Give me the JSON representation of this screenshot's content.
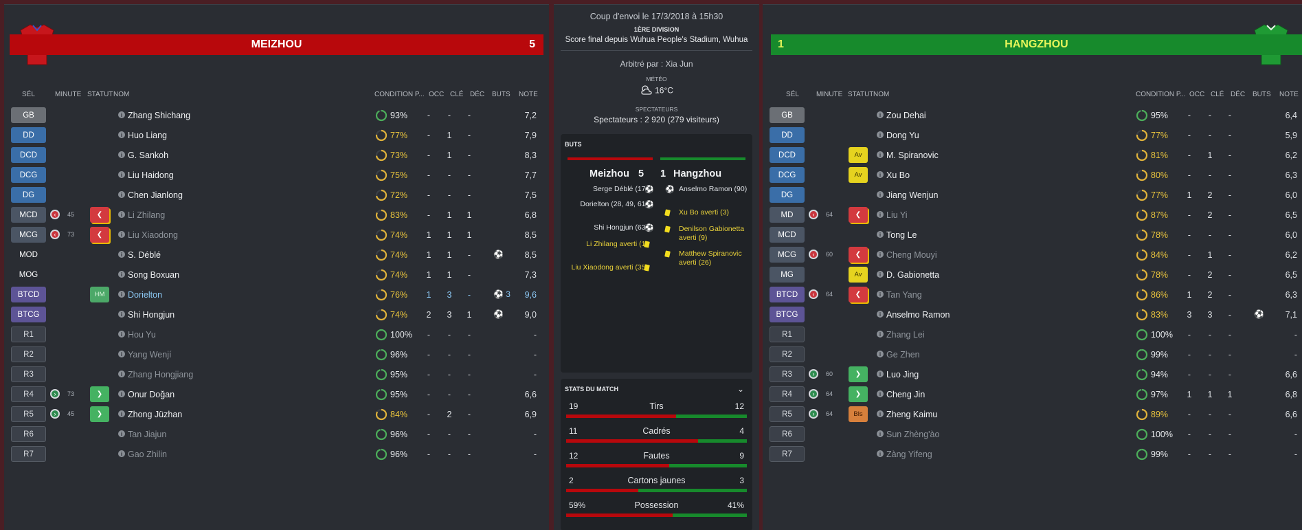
{
  "home": {
    "name": "MEIZHOU",
    "score": "5",
    "color": "#b8080c",
    "headers": {
      "sel": "SÉL",
      "minute": "MINUTE",
      "statut": "STATUT",
      "nom": "NOM",
      "cond": "CONDITION P...",
      "occ": "OCC",
      "cle": "CLÉ",
      "dec": "DÉC",
      "buts": "BUTS",
      "note": "NOTE"
    },
    "players": [
      {
        "pos": "GB",
        "pk": "gk",
        "name": "Zhang Shichang",
        "cond": "93%",
        "cc": "g",
        "occ": "-",
        "cle": "-",
        "dec": "-",
        "buts": "",
        "note": "7,2"
      },
      {
        "pos": "DD",
        "pk": "def",
        "name": "Huo Liang",
        "cond": "77%",
        "cc": "y",
        "occ": "-",
        "cle": "1",
        "dec": "-",
        "buts": "",
        "note": "7,9"
      },
      {
        "pos": "DCD",
        "pk": "def",
        "name": "G. Sankoh",
        "cond": "73%",
        "cc": "y",
        "occ": "-",
        "cle": "1",
        "dec": "-",
        "buts": "",
        "note": "8,3"
      },
      {
        "pos": "DCG",
        "pk": "def",
        "name": "Liu Haidong",
        "cond": "75%",
        "cc": "y",
        "occ": "-",
        "cle": "-",
        "dec": "-",
        "buts": "",
        "note": "7,7"
      },
      {
        "pos": "DG",
        "pk": "def",
        "name": "Chen Jianlong",
        "cond": "72%",
        "cc": "y",
        "occ": "-",
        "cle": "-",
        "dec": "-",
        "buts": "",
        "note": "7,5"
      },
      {
        "pos": "MCD",
        "pk": "mid",
        "sub": "out",
        "minute": "45",
        "status": "red",
        "status_text": "❮",
        "name": "Li Zhilang",
        "nk": "out",
        "cond": "83%",
        "cc": "y",
        "occ": "-",
        "cle": "1",
        "dec": "1",
        "buts": "",
        "note": "6,8"
      },
      {
        "pos": "MCG",
        "pk": "mid",
        "sub": "out",
        "minute": "73",
        "status": "red",
        "status_text": "❮",
        "name": "Liu Xiaodong",
        "nk": "out",
        "cond": "74%",
        "cc": "y",
        "occ": "1",
        "cle": "1",
        "dec": "1",
        "buts": "",
        "note": "8,5"
      },
      {
        "pos": "MOD",
        "pk": "plain",
        "name": "S. Déblé",
        "cond": "74%",
        "cc": "y",
        "occ": "1",
        "cle": "1",
        "dec": "-",
        "buts": "⚽",
        "note": "8,5"
      },
      {
        "pos": "MOG",
        "pk": "plain",
        "name": "Song Boxuan",
        "cond": "74%",
        "cc": "y",
        "occ": "1",
        "cle": "1",
        "dec": "-",
        "buts": "",
        "note": "7,3"
      },
      {
        "pos": "BTCD",
        "pk": "att",
        "status": "hm",
        "status_text": "HM",
        "name": "Dorielton",
        "nk": "star",
        "cond": "76%",
        "cc": "y",
        "occ": "1",
        "cle": "3",
        "dec": "-",
        "buts": "⚽ 3",
        "note": "9,6",
        "star": true
      },
      {
        "pos": "BTCG",
        "pk": "att",
        "name": "Shi Hongjun",
        "cond": "74%",
        "cc": "y",
        "occ": "2",
        "cle": "3",
        "dec": "1",
        "buts": "⚽",
        "note": "9,0"
      },
      {
        "pos": "R1",
        "pk": "res",
        "name": "Hou Yu",
        "nk": "dim",
        "cond": "100%",
        "cc": "g",
        "occ": "-",
        "cle": "-",
        "dec": "-",
        "buts": "",
        "note": "-"
      },
      {
        "pos": "R2",
        "pk": "res",
        "name": "Yang Wenjí",
        "nk": "dim",
        "cond": "96%",
        "cc": "g",
        "occ": "-",
        "cle": "-",
        "dec": "-",
        "buts": "",
        "note": "-"
      },
      {
        "pos": "R3",
        "pk": "res",
        "name": "Zhang Hongjiang",
        "nk": "dim",
        "cond": "95%",
        "cc": "g",
        "occ": "-",
        "cle": "-",
        "dec": "-",
        "buts": "",
        "note": "-"
      },
      {
        "pos": "R4",
        "pk": "res",
        "sub": "in",
        "minute": "73",
        "status": "green",
        "status_text": "❯",
        "name": "Onur Doğan",
        "cond": "95%",
        "cc": "g",
        "occ": "-",
        "cle": "-",
        "dec": "-",
        "buts": "",
        "note": "6,6"
      },
      {
        "pos": "R5",
        "pk": "res",
        "sub": "in",
        "minute": "45",
        "status": "green",
        "status_text": "❯",
        "name": "Zhong Jüzhan",
        "cond": "84%",
        "cc": "y",
        "occ": "-",
        "cle": "2",
        "dec": "-",
        "buts": "",
        "note": "6,9"
      },
      {
        "pos": "R6",
        "pk": "res",
        "name": "Tan Jiajun",
        "nk": "dim",
        "cond": "96%",
        "cc": "g",
        "occ": "-",
        "cle": "-",
        "dec": "-",
        "buts": "",
        "note": "-"
      },
      {
        "pos": "R7",
        "pk": "res",
        "name": "Gao Zhilin",
        "nk": "dim",
        "cond": "96%",
        "cc": "g",
        "occ": "-",
        "cle": "-",
        "dec": "-",
        "buts": "",
        "note": "-"
      }
    ]
  },
  "away": {
    "name": "HANGZHOU",
    "score": "1",
    "color": "#178a2c",
    "headers": {
      "sel": "SÉL",
      "minute": "MINUTE",
      "statut": "STATUT",
      "nom": "NOM",
      "cond": "CONDITION P...",
      "occ": "OCC",
      "cle": "CLÉ",
      "dec": "DÉC",
      "buts": "BUTS",
      "note": "NOTE"
    },
    "players": [
      {
        "pos": "GB",
        "pk": "gk",
        "name": "Zou Dehai",
        "cond": "95%",
        "cc": "g",
        "occ": "-",
        "cle": "-",
        "dec": "-",
        "buts": "",
        "note": "6,4"
      },
      {
        "pos": "DD",
        "pk": "def",
        "name": "Dong Yu",
        "cond": "77%",
        "cc": "y",
        "occ": "-",
        "cle": "-",
        "dec": "-",
        "buts": "",
        "note": "5,9"
      },
      {
        "pos": "DCD",
        "pk": "def",
        "status": "av",
        "status_text": "Av",
        "name": "M. Spiranovic",
        "cond": "81%",
        "cc": "y",
        "occ": "-",
        "cle": "1",
        "dec": "-",
        "buts": "",
        "note": "6,2"
      },
      {
        "pos": "DCG",
        "pk": "def",
        "status": "av",
        "status_text": "Av",
        "name": "Xu Bo",
        "cond": "80%",
        "cc": "y",
        "occ": "-",
        "cle": "-",
        "dec": "-",
        "buts": "",
        "note": "6,3"
      },
      {
        "pos": "DG",
        "pk": "def",
        "name": "Jiang Wenjun",
        "cond": "77%",
        "cc": "y",
        "occ": "1",
        "cle": "2",
        "dec": "-",
        "buts": "",
        "note": "6,0"
      },
      {
        "pos": "MD",
        "pk": "mid",
        "sub": "out",
        "minute": "64",
        "status": "red",
        "status_text": "❮",
        "name": "Liu Yi",
        "nk": "out",
        "cond": "87%",
        "cc": "y",
        "occ": "-",
        "cle": "2",
        "dec": "-",
        "buts": "",
        "note": "6,5"
      },
      {
        "pos": "MCD",
        "pk": "mid",
        "name": "Tong Le",
        "cond": "78%",
        "cc": "y",
        "occ": "-",
        "cle": "-",
        "dec": "-",
        "buts": "",
        "note": "6,0"
      },
      {
        "pos": "MCG",
        "pk": "mid",
        "sub": "out",
        "minute": "60",
        "status": "red",
        "status_text": "❮",
        "name": "Cheng Mouyi",
        "nk": "out",
        "cond": "84%",
        "cc": "y",
        "occ": "-",
        "cle": "1",
        "dec": "-",
        "buts": "",
        "note": "6,2"
      },
      {
        "pos": "MG",
        "pk": "mid",
        "status": "av",
        "status_text": "Av",
        "name": "D. Gabionetta",
        "cond": "78%",
        "cc": "y",
        "occ": "-",
        "cle": "2",
        "dec": "-",
        "buts": "",
        "note": "6,5"
      },
      {
        "pos": "BTCD",
        "pk": "att",
        "sub": "out",
        "minute": "64",
        "status": "red",
        "status_text": "❮",
        "name": "Tan Yang",
        "nk": "out",
        "cond": "86%",
        "cc": "y",
        "occ": "1",
        "cle": "2",
        "dec": "-",
        "buts": "",
        "note": "6,3"
      },
      {
        "pos": "BTCG",
        "pk": "att",
        "name": "Anselmo Ramon",
        "cond": "83%",
        "cc": "y",
        "occ": "3",
        "cle": "3",
        "dec": "-",
        "buts": "⚽",
        "note": "7,1"
      },
      {
        "pos": "R1",
        "pk": "res",
        "name": "Zhang Lei",
        "nk": "dim",
        "cond": "100%",
        "cc": "g",
        "occ": "-",
        "cle": "-",
        "dec": "-",
        "buts": "",
        "note": "-"
      },
      {
        "pos": "R2",
        "pk": "res",
        "name": "Ge Zhen",
        "nk": "dim",
        "cond": "99%",
        "cc": "g",
        "occ": "-",
        "cle": "-",
        "dec": "-",
        "buts": "",
        "note": "-"
      },
      {
        "pos": "R3",
        "pk": "res",
        "sub": "in",
        "minute": "60",
        "status": "green",
        "status_text": "❯",
        "name": "Luo Jing",
        "cond": "94%",
        "cc": "g",
        "occ": "-",
        "cle": "-",
        "dec": "-",
        "buts": "",
        "note": "6,6"
      },
      {
        "pos": "R4",
        "pk": "res",
        "sub": "in",
        "minute": "64",
        "status": "green",
        "status_text": "❯",
        "name": "Cheng Jin",
        "cond": "97%",
        "cc": "g",
        "occ": "1",
        "cle": "1",
        "dec": "1",
        "buts": "",
        "note": "6,8"
      },
      {
        "pos": "R5",
        "pk": "res",
        "sub": "in",
        "minute": "64",
        "status": "bls",
        "status_text": "Bls",
        "name": "Zheng Kaimu",
        "cond": "89%",
        "cc": "y",
        "occ": "-",
        "cle": "-",
        "dec": "-",
        "buts": "",
        "note": "6,6"
      },
      {
        "pos": "R6",
        "pk": "res",
        "name": "Sun Zhèng'ào",
        "nk": "dim",
        "cond": "100%",
        "cc": "g",
        "occ": "-",
        "cle": "-",
        "dec": "-",
        "buts": "",
        "note": "-"
      },
      {
        "pos": "R7",
        "pk": "res",
        "name": "Zàng Yifeng",
        "nk": "dim",
        "cond": "99%",
        "cc": "g",
        "occ": "-",
        "cle": "-",
        "dec": "-",
        "buts": "",
        "note": "-"
      }
    ]
  },
  "match": {
    "kickoff": "Coup d'envoi le 17/3/2018 à 15h30",
    "division": "1ÈRE DIVISION",
    "final": "Score final depuis Wuhua People's Stadium, Wuhua",
    "referee": "Arbitré par : Xia Jun",
    "weather_label": "MÉTÉO",
    "weather_value": "16°C",
    "spectators_label": "SPECTATEURS",
    "spectators_value": "Spectateurs : 2 920 (279 visiteurs)"
  },
  "goals": {
    "title": "BUTS",
    "home_team": "Meizhou",
    "home_score": "5",
    "away_team": "Hangzhou",
    "away_score": "1",
    "home_events": [
      {
        "text": "Serge Déblé (17)",
        "type": "goal"
      },
      {
        "text": "Dorielton (28, 49, 61)",
        "type": "goal"
      },
      {
        "text": "Shi Hongjun (63)",
        "type": "goal"
      },
      {
        "text": "Li Zhilang averti (1)",
        "type": "yellow"
      },
      {
        "text": "Liu Xiaodong averti (35)",
        "type": "yellow"
      }
    ],
    "away_events": [
      {
        "text": "Anselmo Ramon (90)",
        "type": "goal"
      },
      {
        "text": "Xu Bo averti (3)",
        "type": "yellow"
      },
      {
        "text": "Denilson Gabionetta averti (9)",
        "type": "yellow"
      },
      {
        "text": "Matthew Spiranovic averti (26)",
        "type": "yellow"
      }
    ]
  },
  "stats": {
    "title": "STATS DU MATCH",
    "rows": [
      {
        "label": "Tirs",
        "home": "19",
        "away": "12",
        "home_share": 0.61
      },
      {
        "label": "Cadrés",
        "home": "11",
        "away": "4",
        "home_share": 0.73
      },
      {
        "label": "Fautes",
        "home": "12",
        "away": "9",
        "home_share": 0.57
      },
      {
        "label": "Cartons jaunes",
        "home": "2",
        "away": "3",
        "home_share": 0.4
      },
      {
        "label": "Possession",
        "home": "59%",
        "away": "41%",
        "home_share": 0.59
      }
    ]
  }
}
